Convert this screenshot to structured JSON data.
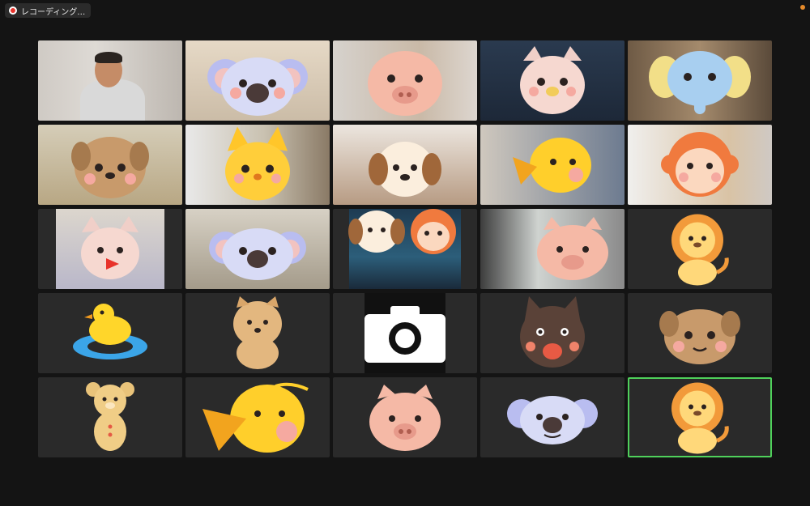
{
  "recording": {
    "label": "レコーディング…",
    "dot_color": "#e8342c"
  },
  "window": {
    "background": "#141414",
    "active_border": "#4fd15b"
  },
  "participants": [
    {
      "row": 1,
      "col": 1,
      "video": true,
      "avatar": "none"
    },
    {
      "row": 1,
      "col": 2,
      "video": true,
      "avatar": "koala-mask"
    },
    {
      "row": 1,
      "col": 3,
      "video": true,
      "avatar": "pig-mask"
    },
    {
      "row": 1,
      "col": 4,
      "video": true,
      "avatar": "cat-mask"
    },
    {
      "row": 1,
      "col": 5,
      "video": true,
      "avatar": "elephant-mask"
    },
    {
      "row": 2,
      "col": 1,
      "video": true,
      "avatar": "dog-mask"
    },
    {
      "row": 2,
      "col": 2,
      "video": true,
      "avatar": "fox-mask"
    },
    {
      "row": 2,
      "col": 3,
      "video": true,
      "avatar": "puppy-mask"
    },
    {
      "row": 2,
      "col": 4,
      "video": true,
      "avatar": "bird-mask"
    },
    {
      "row": 2,
      "col": 5,
      "video": true,
      "avatar": "monkey-mask"
    },
    {
      "row": 3,
      "col": 1,
      "video": true,
      "avatar": "cat-mask"
    },
    {
      "row": 3,
      "col": 2,
      "video": true,
      "avatar": "koala-mask"
    },
    {
      "row": 3,
      "col": 3,
      "video": true,
      "avatar": "puppy-monkey-mask"
    },
    {
      "row": 3,
      "col": 4,
      "video": true,
      "avatar": "pig-mask"
    },
    {
      "row": 3,
      "col": 5,
      "video": false,
      "avatar": "lion"
    },
    {
      "row": 4,
      "col": 1,
      "video": false,
      "avatar": "duck"
    },
    {
      "row": 4,
      "col": 2,
      "video": false,
      "avatar": "pomeranian"
    },
    {
      "row": 4,
      "col": 3,
      "video": false,
      "avatar": "camera-icon"
    },
    {
      "row": 4,
      "col": 4,
      "video": false,
      "avatar": "wolf"
    },
    {
      "row": 4,
      "col": 5,
      "video": false,
      "avatar": "dog"
    },
    {
      "row": 5,
      "col": 1,
      "video": false,
      "avatar": "teddy-bear"
    },
    {
      "row": 5,
      "col": 2,
      "video": false,
      "avatar": "bird"
    },
    {
      "row": 5,
      "col": 3,
      "video": false,
      "avatar": "pig"
    },
    {
      "row": 5,
      "col": 4,
      "video": false,
      "avatar": "koala"
    },
    {
      "row": 5,
      "col": 5,
      "video": false,
      "avatar": "lion",
      "active_speaker": true
    }
  ]
}
